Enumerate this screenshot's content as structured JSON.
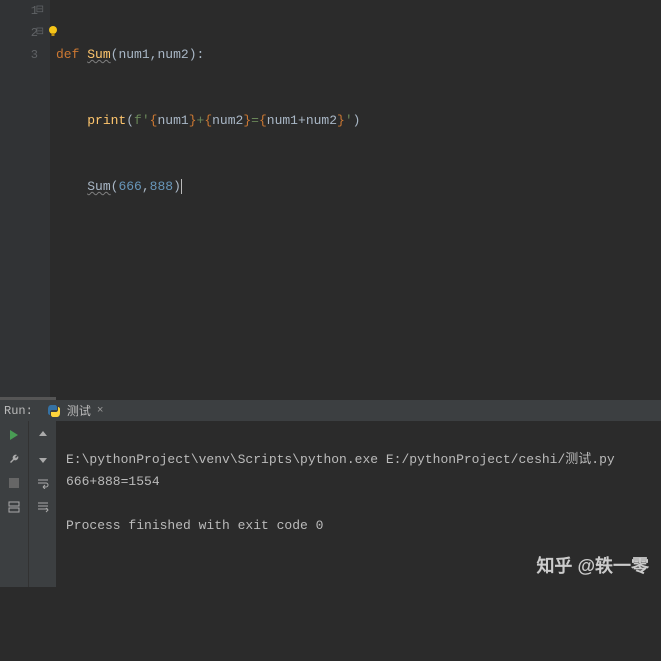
{
  "editor": {
    "lines": [
      "1",
      "2",
      "3"
    ],
    "code": {
      "l1": {
        "def": "def ",
        "fn": "Sum",
        "open": "(",
        "p1": "num1",
        "comma": ",",
        "p2": "num2",
        "close": "):"
      },
      "l2": {
        "indent": "    ",
        "print": "print",
        "open": "(",
        "f": "f'",
        "b1": "{",
        "n1": "num1",
        "b2": "}",
        "plus": "+",
        "b3": "{",
        "n2": "num2",
        "b4": "}",
        "eq": "=",
        "b5": "{",
        "n3": "num1",
        "plus2": "+",
        "n4": "num2",
        "b6": "}",
        "end": "'",
        "close": ")"
      },
      "l3": {
        "indent": "    ",
        "fn": "Sum",
        "open": "(",
        "a1": "666",
        "comma": ",",
        "a2": "888",
        "close": ")"
      }
    }
  },
  "run": {
    "label": "Run:",
    "tab_name": "测试",
    "console": {
      "cmd": "E:\\pythonProject\\venv\\Scripts\\python.exe E:/pythonProject/ceshi/测试.py",
      "out": "666+888=1554",
      "exit": "Process finished with exit code 0"
    }
  },
  "watermark": "知乎 @轶一零"
}
